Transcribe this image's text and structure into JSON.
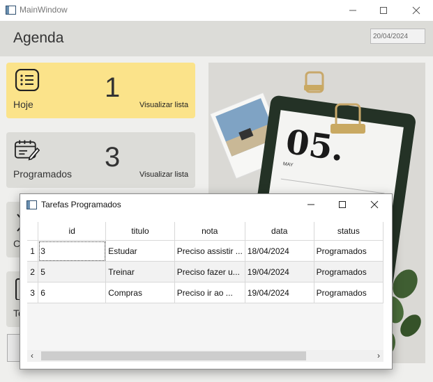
{
  "window": {
    "title": "MainWindow"
  },
  "header": {
    "title": "Agenda",
    "date": "20/04/2024"
  },
  "cards": [
    {
      "label": "Hoje",
      "count": "1",
      "link": "Visualizar lista"
    },
    {
      "label": "Programados",
      "count": "3",
      "link": "Visualizar lista"
    },
    {
      "label": "C"
    },
    {
      "label": "To"
    }
  ],
  "dialog": {
    "title": "Tarefas Programados",
    "columns": [
      "id",
      "titulo",
      "nota",
      "data",
      "status"
    ],
    "rows": [
      {
        "num": "1",
        "id": "3",
        "titulo": "Estudar",
        "nota": "Preciso assistir ...",
        "data": "18/04/2024",
        "status": "Programados"
      },
      {
        "num": "2",
        "id": "5",
        "titulo": "Treinar",
        "nota": "Preciso fazer u...",
        "data": "19/04/2024",
        "status": "Programados"
      },
      {
        "num": "3",
        "id": "6",
        "titulo": "Compras",
        "nota": "Preciso ir ao ...",
        "data": "19/04/2024",
        "status": "Programados"
      }
    ]
  },
  "image": {
    "calendar_text": "05.",
    "month_text": "MAY"
  }
}
